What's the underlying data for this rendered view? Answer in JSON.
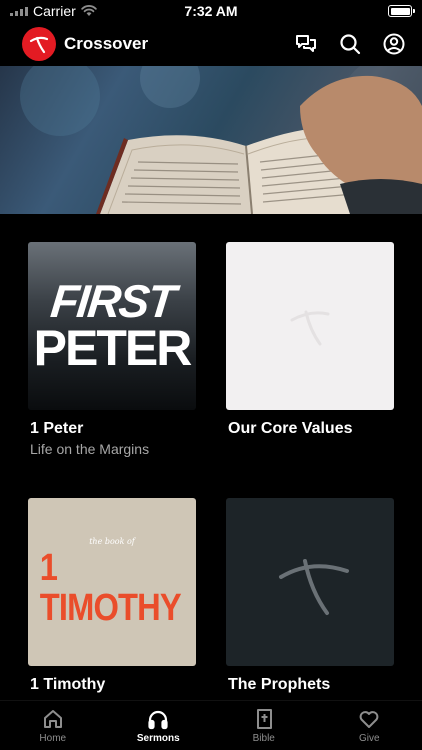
{
  "status_bar": {
    "carrier": "Carrier",
    "time": "7:32 AM"
  },
  "header": {
    "title": "Crossover",
    "icons": [
      "chat-bubbles-icon",
      "search-icon",
      "account-icon"
    ]
  },
  "sermons": [
    {
      "title": "1 Peter",
      "subtitle": "Life on the Margins",
      "art_line1": "FIRST",
      "art_line2": "PETER"
    },
    {
      "title": "Our Core Values",
      "subtitle": ""
    },
    {
      "title": "1 Timothy",
      "subtitle": "",
      "art_small": "the book of",
      "art_big": "1 TIMOTHY"
    },
    {
      "title": "The Prophets",
      "subtitle": ""
    }
  ],
  "tabbar": {
    "tabs": [
      {
        "label": "Home",
        "icon": "home-icon"
      },
      {
        "label": "Sermons",
        "icon": "headphones-icon",
        "active": true
      },
      {
        "label": "Bible",
        "icon": "bible-icon"
      },
      {
        "label": "Give",
        "icon": "heart-icon"
      }
    ]
  },
  "colors": {
    "brand_red": "#e31b23",
    "timothy_orange": "#ea4d2b",
    "inactive_tab": "#8e8e8e"
  }
}
